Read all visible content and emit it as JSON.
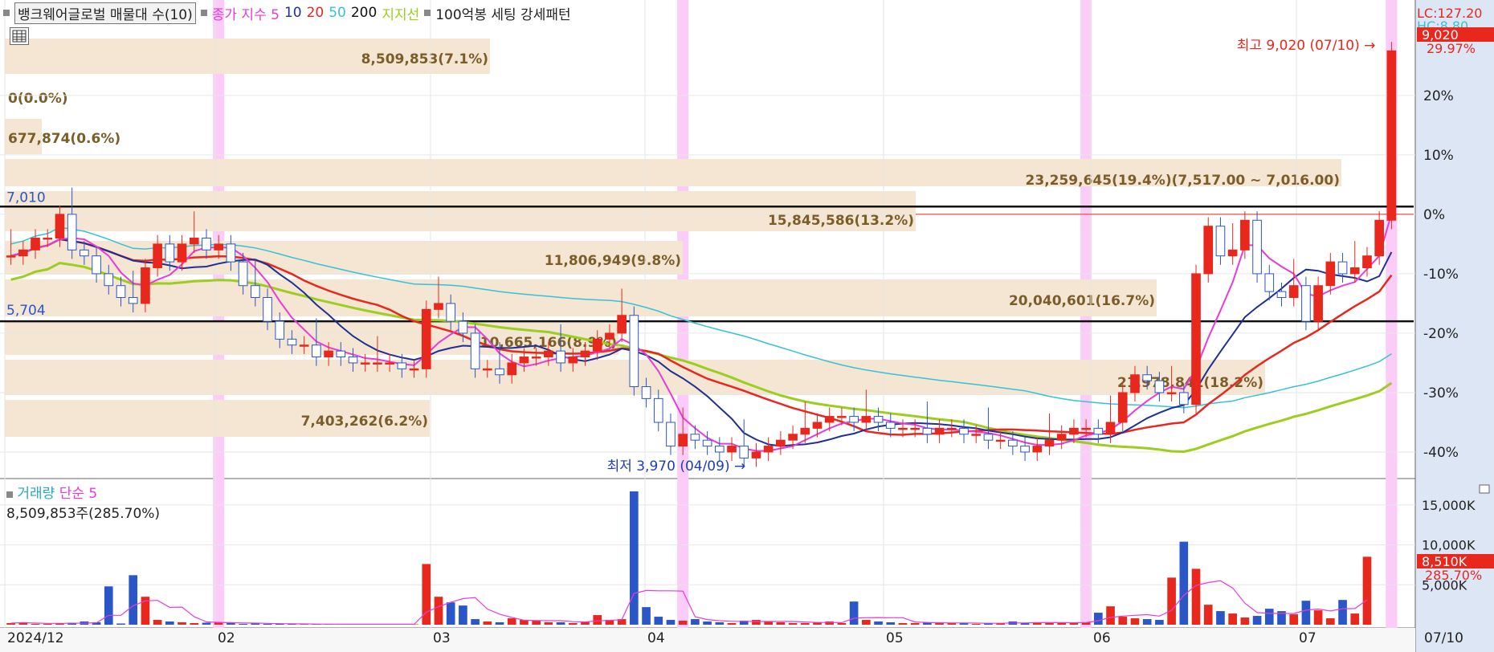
{
  "legend": {
    "title": "뱅크웨어글로벌 매물대 수(10)",
    "ma_label": "종가 지수 5",
    "ma10": "10",
    "ma20": "20",
    "ma50": "50",
    "ma200": "200",
    "support": "지지선",
    "setting": "100억봉 세팅 강세패턴"
  },
  "right_top": {
    "lc": "LC:127.20",
    "hc": "HC:8.80"
  },
  "price_badge": "9,020",
  "price_pct": "29.97%",
  "volume_badge": "8,510K",
  "volume_pct": "285.70%",
  "annotations": {
    "high": "최고 9,020 (07/10)",
    "low": "최저 3,970 (04/09)",
    "level_hi": "7,010",
    "level_lo": "5,704"
  },
  "volume_legend": {
    "name": "거래량",
    "ma": "단순 5",
    "value": "8,509,853주(285.70%)"
  },
  "chart_data": {
    "type": "candlestick",
    "volume_profile": [
      {
        "label": "8,509,853(7.1%)"
      },
      {
        "label": "0(0.0%)"
      },
      {
        "label": "677,874(0.6%)"
      },
      {
        "label": "23,259,645(19.4%)(7,517.00 ~ 7,016.00)"
      },
      {
        "label": "15,845,586(13.2%)"
      },
      {
        "label": "11,806,949(9.8%)"
      },
      {
        "label": "20,040,601(16.7%)"
      },
      {
        "label": "10,665,166(8.9%)"
      },
      {
        "label": "21,978,841(18.2%)"
      },
      {
        "label": "7,403,262(6.2%)"
      }
    ],
    "y_ticks": [
      "20%",
      "10%",
      "0%",
      "-10%",
      "-20%",
      "-30%",
      "-40%"
    ],
    "y_tick_values": [
      20,
      10,
      0,
      -10,
      -20,
      -30,
      -40
    ],
    "x_ticks": [
      "2024/12",
      "02",
      "03",
      "04",
      "05",
      "06",
      "07",
      "07/10"
    ],
    "vol_ticks": [
      "15,000K",
      "10,000K",
      "5,000K"
    ],
    "vol_tick_values": [
      15000,
      10000,
      5000
    ],
    "close_pct": [
      -7,
      -6,
      -4,
      -4,
      0,
      -6,
      -7,
      -10,
      -12,
      -14,
      -15,
      -9,
      -5,
      -8,
      -5,
      -4,
      -6,
      -5,
      -8,
      -12,
      -14,
      -18,
      -21,
      -22,
      -22,
      -24,
      -23,
      -24,
      -25,
      -25,
      -25,
      -25,
      -26,
      -26,
      -16,
      -15,
      -18,
      -20,
      -26,
      -26,
      -27,
      -25,
      -24,
      -24,
      -23,
      -25,
      -24,
      -23,
      -21,
      -20,
      -17,
      -29,
      -31,
      -35,
      -39,
      -37,
      -38,
      -39,
      -40,
      -39,
      -41,
      -40,
      -39,
      -38,
      -37,
      -36,
      -35,
      -34,
      -34,
      -35,
      -34,
      -35,
      -36,
      -36,
      -36,
      -37,
      -36,
      -36,
      -37,
      -37,
      -38,
      -38,
      -39,
      -40,
      -39,
      -38,
      -37,
      -36,
      -36,
      -37,
      -35,
      -30,
      -27,
      -28,
      -30,
      -30,
      -32,
      -10,
      -2,
      -7,
      -6,
      -1,
      -10,
      -13,
      -14,
      -12,
      -18,
      -12,
      -8,
      -10,
      -9,
      -7,
      -1,
      27.5
    ],
    "volume_k": [
      200,
      300,
      100,
      100,
      150,
      250,
      400,
      300,
      4800,
      150,
      6200,
      3500,
      600,
      400,
      300,
      200,
      250,
      300,
      200,
      100,
      150,
      100,
      120,
      80,
      60,
      50,
      50,
      80,
      60,
      50,
      50,
      40,
      100,
      50,
      7600,
      3500,
      2800,
      2400,
      700,
      400,
      300,
      800,
      600,
      500,
      300,
      300,
      200,
      400,
      1200,
      600,
      700,
      16700,
      2200,
      1000,
      600,
      500,
      700,
      400,
      300,
      200,
      500,
      600,
      400,
      300,
      200,
      200,
      300,
      400,
      200,
      2900,
      600,
      400,
      300,
      200,
      200,
      300,
      200,
      200,
      200,
      100,
      200,
      200,
      400,
      200,
      300,
      200,
      200,
      300,
      300,
      1500,
      2300,
      1000,
      800,
      700,
      600,
      5900,
      10400,
      7000,
      2500,
      1700,
      1400,
      900,
      1100,
      2000,
      1700,
      1300,
      3000,
      1800,
      800,
      3100,
      1400,
      8510
    ],
    "max_pct": 32,
    "min_pct": -45,
    "vol_max": 17500
  },
  "colors": {
    "up": "#e8271d",
    "down": "#2a56c7",
    "ma5": "#e83bd8",
    "ma10": "#1f2f96",
    "ma20": "#e8271d",
    "ma50": "#35c2d8",
    "ma200": "#9ccd1f",
    "band": "#f4e6d2",
    "highlight": "#fbccf7",
    "axis_bg": "#dde6f5"
  },
  "tab_marks": [
    "02",
    "03"
  ]
}
